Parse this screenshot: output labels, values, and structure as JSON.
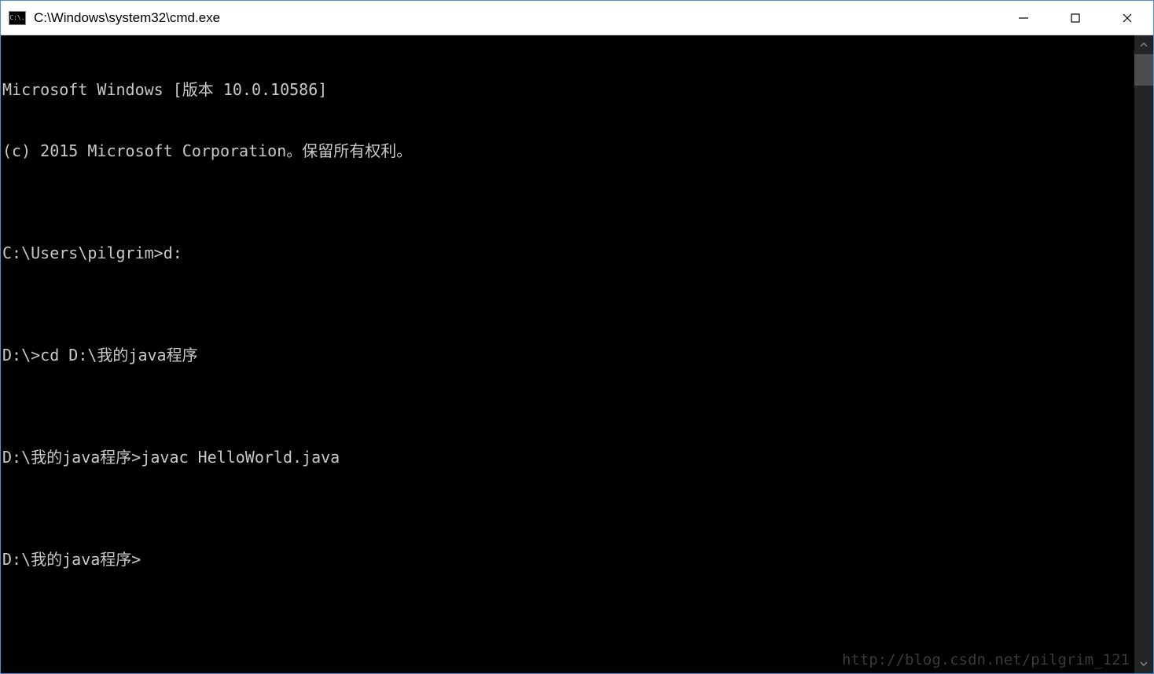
{
  "titlebar": {
    "icon_label": "C:\\.",
    "title": "C:\\Windows\\system32\\cmd.exe"
  },
  "console": {
    "lines": [
      "Microsoft Windows [版本 10.0.10586]",
      "(c) 2015 Microsoft Corporation。保留所有权利。",
      "",
      "C:\\Users\\pilgrim>d:",
      "",
      "D:\\>cd D:\\我的java程序",
      "",
      "D:\\我的java程序>javac HelloWorld.java",
      "",
      "D:\\我的java程序>"
    ]
  },
  "watermark": "http://blog.csdn.net/pilgrim_121"
}
